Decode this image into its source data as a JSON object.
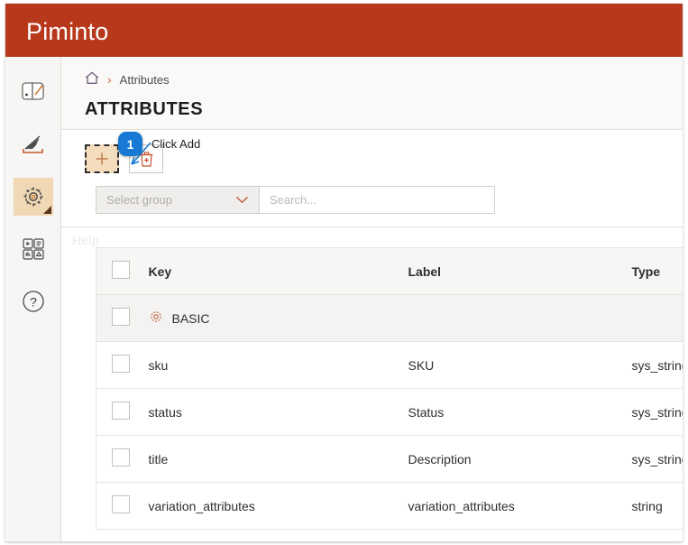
{
  "app": {
    "brand": "Piminto",
    "brand_color": "#b8381c",
    "accent_color": "#d4643a",
    "highlight_color": "#f3ddbe",
    "callout_color": "#1779d3"
  },
  "sidebar": {
    "items": [
      {
        "icon": "catalog-book-icon",
        "active": false
      },
      {
        "icon": "data-fan-icon",
        "active": false
      },
      {
        "icon": "settings-gear-icon",
        "active": true
      },
      {
        "icon": "assets-grid-icon",
        "active": false
      },
      {
        "icon": "help-question-icon",
        "active": false
      }
    ]
  },
  "breadcrumb": {
    "home_icon": "home-icon",
    "separator": "›",
    "current": "Attributes"
  },
  "page": {
    "title": "ATTRIBUTES",
    "help_label": "Help"
  },
  "toolbar": {
    "add_label": "+",
    "delete_icon": "trash-icon",
    "select_group_placeholder": "Select group",
    "search_placeholder": "Search..."
  },
  "callout": {
    "number": "1",
    "text": "Click Add"
  },
  "table": {
    "columns": [
      "",
      "Key",
      "Label",
      "Type"
    ],
    "group_row": {
      "icon": "gear-icon",
      "label": "BASIC"
    },
    "rows": [
      {
        "key": "sku",
        "label": "SKU",
        "type": "sys_string"
      },
      {
        "key": "status",
        "label": "Status",
        "type": "sys_string"
      },
      {
        "key": "title",
        "label": "Description",
        "type": "sys_string"
      },
      {
        "key": "variation_attributes",
        "label": "variation_attributes",
        "type": "string"
      }
    ]
  }
}
